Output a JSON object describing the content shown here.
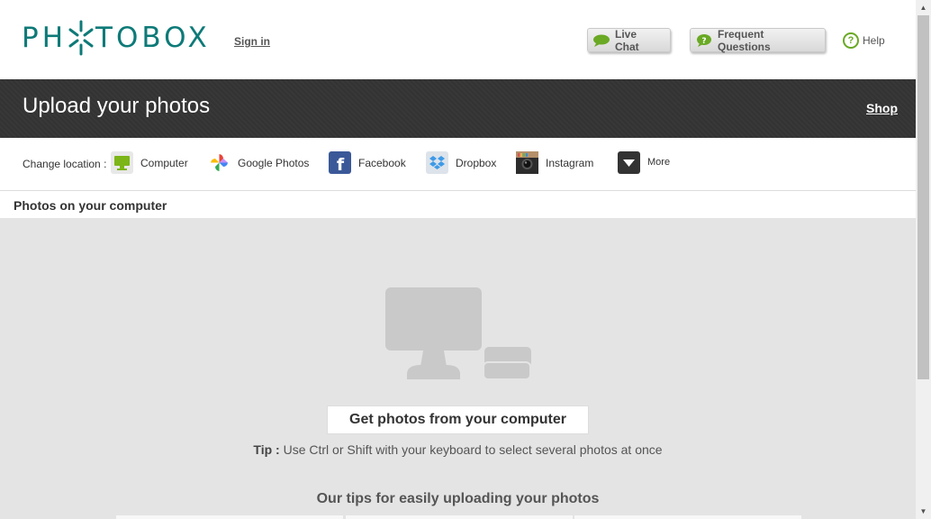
{
  "header": {
    "logo_text_left": "PH",
    "logo_text_right": "TOBOX",
    "logo_color": "#0d7a78",
    "sign_in": "Sign in",
    "live_chat": "Live Chat",
    "faq": "Frequent Questions",
    "help": "Help",
    "accent_green": "#6aa924"
  },
  "banner": {
    "title": "Upload your photos",
    "shop": "Shop",
    "background": "#333333"
  },
  "locations": {
    "label": "Change location :",
    "items": [
      {
        "label": "Computer",
        "icon": "computer-icon"
      },
      {
        "label": "Google Photos",
        "icon": "google-photos-icon"
      },
      {
        "label": "Facebook",
        "icon": "facebook-icon"
      },
      {
        "label": "Dropbox",
        "icon": "dropbox-icon"
      },
      {
        "label": "Instagram",
        "icon": "instagram-icon"
      },
      {
        "label": "More",
        "icon": "chevron-down-icon"
      }
    ]
  },
  "section": {
    "title": "Photos on your computer"
  },
  "main": {
    "get_photos_button": "Get photos from your computer",
    "tip_label": "Tip :",
    "tip_text": " Use Ctrl or Shift with your keyboard to select several photos at once",
    "tips_title": "Our tips for easily uploading your photos"
  }
}
